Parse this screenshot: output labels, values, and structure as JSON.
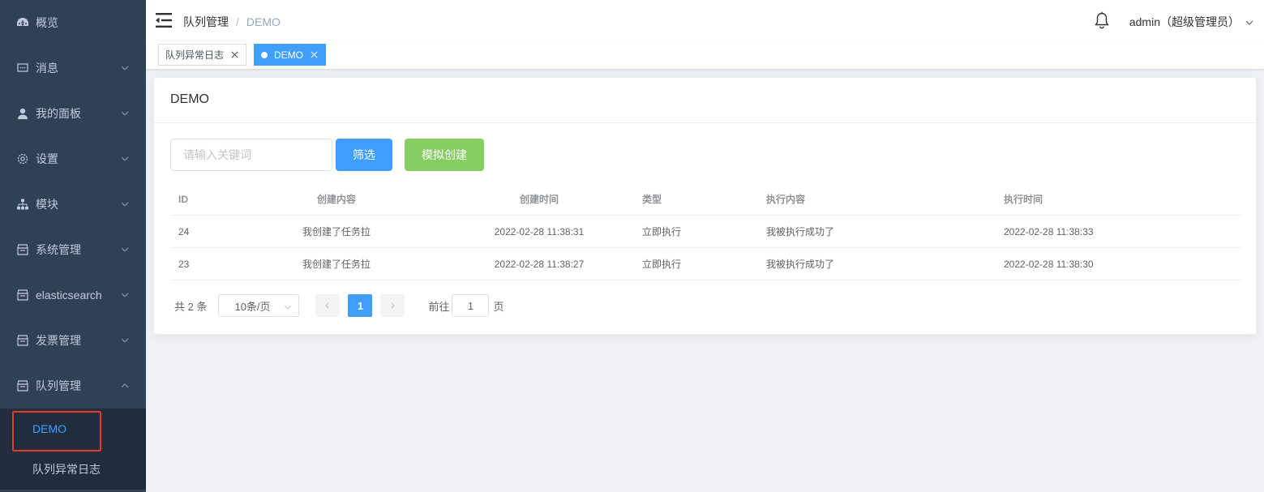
{
  "sidebar": {
    "items": [
      {
        "label": "概览",
        "icon": "dashboard-icon"
      },
      {
        "label": "消息",
        "icon": "message-icon"
      },
      {
        "label": "我的面板",
        "icon": "user-icon"
      },
      {
        "label": "设置",
        "icon": "gear-icon"
      },
      {
        "label": "模块",
        "icon": "tree-icon"
      },
      {
        "label": "系统管理",
        "icon": "box-icon"
      },
      {
        "label": "elasticsearch",
        "icon": "box-icon"
      },
      {
        "label": "发票管理",
        "icon": "box-icon"
      },
      {
        "label": "队列管理",
        "icon": "box-icon"
      }
    ],
    "submenu": [
      {
        "label": "DEMO",
        "active": true
      },
      {
        "label": "队列异常日志",
        "active": false
      }
    ],
    "background": "#304156",
    "submenu_background": "#1f2d3d",
    "active_color": "#409eff"
  },
  "header": {
    "breadcrumb": [
      "队列管理",
      "DEMO"
    ],
    "separator": "/",
    "user": "admin（超级管理员）"
  },
  "tags": [
    {
      "label": "队列异常日志",
      "active": false
    },
    {
      "label": "DEMO",
      "active": true
    }
  ],
  "card": {
    "title": "DEMO",
    "search_placeholder": "请输入关键词",
    "filter_button": "筛选",
    "create_button": "模拟创建"
  },
  "table": {
    "columns": [
      "ID",
      "创建内容",
      "创建时间",
      "类型",
      "执行内容",
      "执行时间"
    ],
    "rows": [
      [
        "24",
        "我创建了任务拉",
        "2022-02-28 11:38:31",
        "立即执行",
        "我被执行成功了",
        "2022-02-28 11:38:33"
      ],
      [
        "23",
        "我创建了任务拉",
        "2022-02-28 11:38:27",
        "立即执行",
        "我被执行成功了",
        "2022-02-28 11:38:30"
      ]
    ]
  },
  "pagination": {
    "total": "共 2 条",
    "page_size": "10条/页",
    "current_page": "1",
    "goto_prefix": "前往",
    "goto_value": "1",
    "goto_suffix": "页"
  },
  "colors": {
    "primary": "#409eff",
    "success": "#85ce61",
    "highlight_box": "#e8392b"
  }
}
